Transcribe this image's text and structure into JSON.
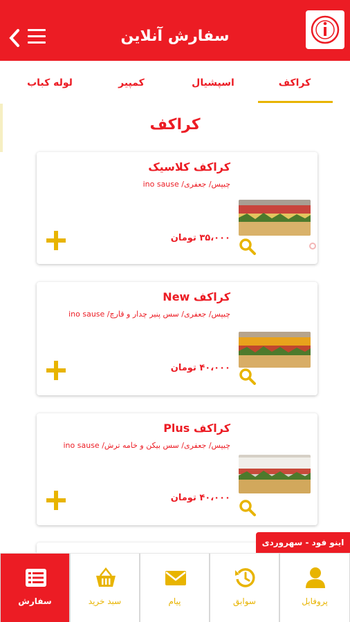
{
  "header": {
    "title": "سفارش آنلاین",
    "back_icon": "chevron-left-icon",
    "menu_icon": "hamburger-menu-icon",
    "logo_icon": "info-logo-icon"
  },
  "tabs": [
    {
      "label": "کراکف",
      "active": true
    },
    {
      "label": "اسپشیال",
      "active": false
    },
    {
      "label": "کمپیر",
      "active": false
    },
    {
      "label": "لوله کباب",
      "active": false
    }
  ],
  "section_title": "کراکف",
  "products": [
    {
      "title": "کراکف کلاسیک",
      "description": "چیپس/ جعفری/ ino sause",
      "price": "۳۵،۰۰۰ تومان"
    },
    {
      "title": "کراکف New",
      "description": "چیپس/ جعفری/ سس پنیر چدار و قارچ/ ino sause",
      "price": "۴۰،۰۰۰ تومان"
    },
    {
      "title": "کراکف Plus",
      "description": "چیپس/ جعفری/ سس بیکن و خامه ترش/ ino sause",
      "price": "۴۰،۰۰۰ تومان"
    }
  ],
  "store_badge": "اینو فود - سهروردی",
  "bottom_nav": [
    {
      "label": "سفارش",
      "icon": "order-list-icon",
      "active": true
    },
    {
      "label": "سبد خرید",
      "icon": "basket-icon",
      "active": false
    },
    {
      "label": "پیام",
      "icon": "envelope-icon",
      "active": false
    },
    {
      "label": "سوابق",
      "icon": "history-icon",
      "active": false
    },
    {
      "label": "پروفایل",
      "icon": "user-icon",
      "active": false
    }
  ],
  "colors": {
    "primary_red": "#ec1c24",
    "accent_yellow": "#e8b400"
  }
}
